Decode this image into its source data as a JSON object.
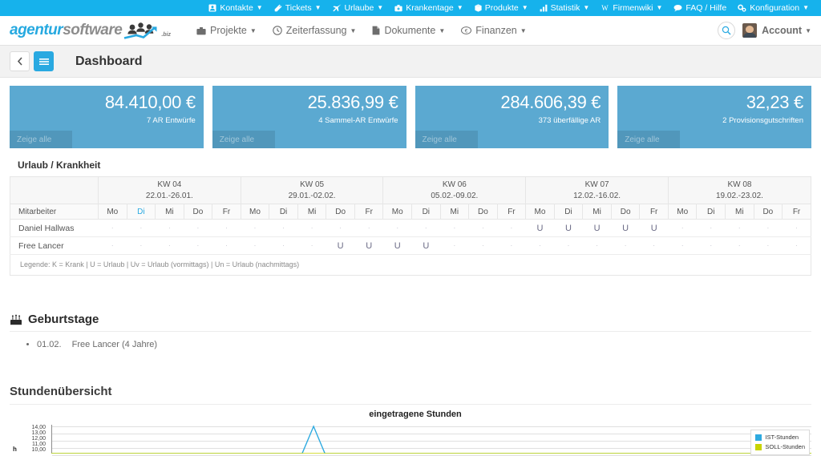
{
  "topbar": {
    "accent": "#16b2ec",
    "items": [
      {
        "label": "Kontakte",
        "icon": "contacts-icon",
        "caret": true
      },
      {
        "label": "Tickets",
        "icon": "ticket-icon",
        "caret": true
      },
      {
        "label": "Urlaube",
        "icon": "plane-icon",
        "caret": true
      },
      {
        "label": "Krankentage",
        "icon": "briefcase-med-icon",
        "caret": true
      },
      {
        "label": "Produkte",
        "icon": "box-icon",
        "caret": true
      },
      {
        "label": "Statistik",
        "icon": "bar-chart-icon",
        "caret": true
      },
      {
        "label": "Firmenwiki",
        "icon": "wiki-w-icon",
        "caret": true
      },
      {
        "label": "FAQ / Hilfe",
        "icon": "comment-icon",
        "caret": false
      },
      {
        "label": "Konfiguration",
        "icon": "gears-icon",
        "caret": true
      }
    ]
  },
  "mainnav": {
    "logo": {
      "part1": "agentur",
      "part2": "software",
      "suffix": ".biz",
      "icon": "people-growth-icon"
    },
    "items": [
      {
        "label": "Projekte",
        "icon": "briefcase-icon",
        "caret": true
      },
      {
        "label": "Zeiterfassung",
        "icon": "clock-icon",
        "caret": true
      },
      {
        "label": "Dokumente",
        "icon": "file-icon",
        "caret": true
      },
      {
        "label": "Finanzen",
        "icon": "money-icon",
        "caret": true
      }
    ],
    "search_icon": "search-icon",
    "account_label": "Account"
  },
  "pagehead": {
    "back_icon": "chevron-left-icon",
    "menu_icon": "hamburger-icon",
    "title": "Dashboard"
  },
  "tiles": {
    "color": "#5ba9d1",
    "show_all_label": "Zeige alle",
    "items": [
      {
        "value": "84.410,00 €",
        "sub": "7 AR Entwürfe"
      },
      {
        "value": "25.836,99 €",
        "sub": "4 Sammel-AR Entwürfe"
      },
      {
        "value": "284.606,39 €",
        "sub": "373 überfällige AR"
      },
      {
        "value": "32,23 €",
        "sub": "2 Provisionsgutschriften"
      }
    ]
  },
  "vacation": {
    "title": "Urlaub / Krankheit",
    "employee_header": "Mitarbeiter",
    "weeks": [
      {
        "kw": "KW 04",
        "range": "22.01.-26.01."
      },
      {
        "kw": "KW 05",
        "range": "29.01.-02.02."
      },
      {
        "kw": "KW 06",
        "range": "05.02.-09.02."
      },
      {
        "kw": "KW 07",
        "range": "12.02.-16.02."
      },
      {
        "kw": "KW 08",
        "range": "19.02.-23.02."
      }
    ],
    "days": [
      "Mo",
      "Di",
      "Mi",
      "Do",
      "Fr"
    ],
    "today_index": 1,
    "today_week_index": 0,
    "today_color": "#29a9e1",
    "empty_mark": "·",
    "rows": [
      {
        "name": "Daniel Hallwas",
        "cells": [
          "·",
          "·",
          "·",
          "·",
          "·",
          "·",
          "·",
          "·",
          "·",
          "·",
          "·",
          "·",
          "·",
          "·",
          "·",
          "U",
          "U",
          "U",
          "U",
          "U",
          "·",
          "·",
          "·",
          "·",
          "·"
        ]
      },
      {
        "name": "Free Lancer",
        "cells": [
          "·",
          "·",
          "·",
          "·",
          "·",
          "·",
          "·",
          "·",
          "U",
          "U",
          "U",
          "U",
          "·",
          "·",
          "·",
          "·",
          "·",
          "·",
          "·",
          "·",
          "·",
          "·",
          "·",
          "·",
          "·"
        ]
      }
    ],
    "legend": "Legende: K = Krank | U = Urlaub | Uv = Urlaub (vormittags) | Un = Urlaub (nachmittags)"
  },
  "birthdays": {
    "title": "Geburtstage",
    "icon": "cake-icon",
    "items": [
      {
        "date": "01.02.",
        "text": "Free Lancer (4 Jahre)"
      }
    ]
  },
  "hours": {
    "title": "Stundenübersicht",
    "chart_data": {
      "type": "line",
      "title": "eingetragene Stunden",
      "xlabel": "",
      "ylabel": "h",
      "ylim": [
        10,
        14
      ],
      "ytick_labels": [
        "14,00",
        "13,00",
        "12,00",
        "11,00",
        "10,00"
      ],
      "grid": true,
      "legend_position": "right",
      "legend": [
        {
          "name": "IST-Stunden",
          "color": "#2eaae0"
        },
        {
          "name": "SOLL-Stunden",
          "color": "#c8d400"
        }
      ],
      "series": [
        {
          "name": "IST-Stunden",
          "color": "#2eaae0",
          "x": [
            0,
            0.33,
            0.345,
            0.36,
            1
          ],
          "values": [
            10,
            10,
            14,
            10,
            10
          ]
        },
        {
          "name": "SOLL-Stunden",
          "color": "#c8d400",
          "x": [
            0,
            1
          ],
          "values": [
            10,
            10
          ]
        }
      ]
    }
  }
}
